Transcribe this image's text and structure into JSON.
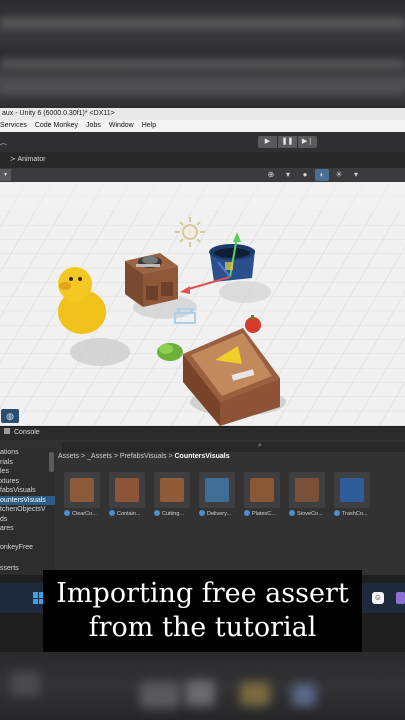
{
  "window": {
    "title": "aux - Unity 6 (6000.0.30f1)* <DX11>"
  },
  "menu": {
    "items": [
      "Services",
      "Code Monkey",
      "Jobs",
      "Window",
      "Help"
    ]
  },
  "toolbar": {
    "play_icon": "play-icon",
    "pause_icon": "pause-icon",
    "step_icon": "step-icon",
    "play_glyph": "▶",
    "pause_glyph": "❚❚",
    "step_glyph": "▶❘"
  },
  "tabs": {
    "animator_label": "Animator",
    "animator_glyph": "≻"
  },
  "scene_toolbar": {
    "icons": [
      "⊕",
      "▾",
      "●",
      "◐",
      "✳",
      "▾"
    ],
    "active_index": 3
  },
  "console": {
    "tab_label": "Console"
  },
  "project": {
    "tree_items": [
      "ations",
      "rials",
      "les",
      "xtures",
      "fabsVisuals",
      "ountersVisuals",
      "tchenObjectsV",
      "ds",
      "ares",
      "",
      "onkeyFree"
    ],
    "tree_selected_index": 5,
    "tree_bottom_label": "sserts",
    "breadcrumb": {
      "parts": [
        "Assets",
        ">",
        "_Assets",
        ">",
        "PrefabsVisuals",
        ">"
      ],
      "current": "CountersVisuals"
    },
    "assets": [
      {
        "label": "ClearCo...",
        "color": "#8a5a3a"
      },
      {
        "label": "Contain...",
        "color": "#8c5636"
      },
      {
        "label": "Cutting...",
        "color": "#8e5a38"
      },
      {
        "label": "Delivery...",
        "color": "#3e6e96"
      },
      {
        "label": "PlatesC...",
        "color": "#8a5836"
      },
      {
        "label": "StoveCo...",
        "color": "#7a5038"
      },
      {
        "label": "TrashCo...",
        "color": "#2e5d9a"
      }
    ]
  },
  "taskbar": {
    "tray_glyph": "☺"
  },
  "caption": {
    "line1": "Importing free assert",
    "line2": "from the tutorial"
  }
}
